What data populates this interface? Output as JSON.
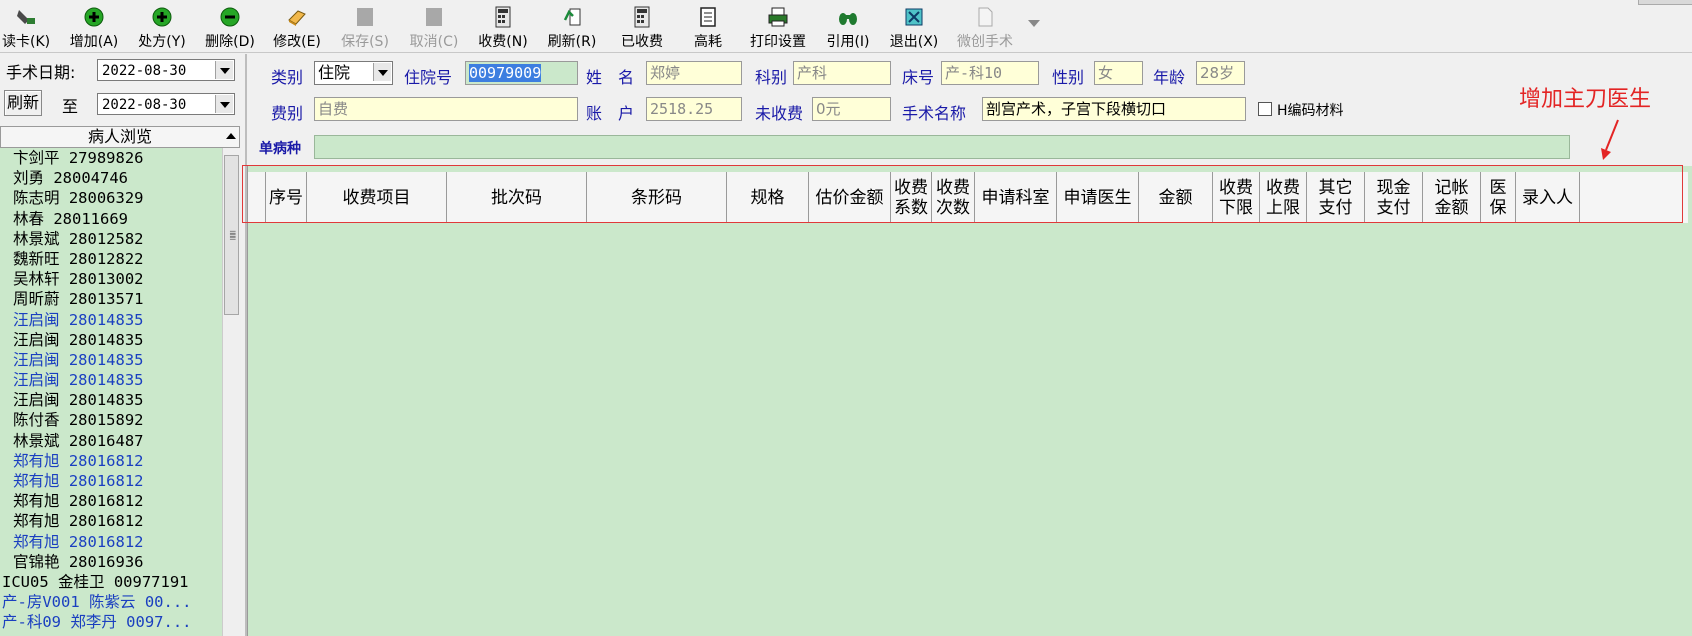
{
  "toolbar": {
    "buttons": [
      {
        "label": "读卡(K)",
        "icon": "card-reader-icon",
        "disabled": false
      },
      {
        "label": "增加(A)",
        "icon": "plus-circle-icon",
        "disabled": false
      },
      {
        "label": "处方(Y)",
        "icon": "plus-circle-icon",
        "disabled": false
      },
      {
        "label": "删除(D)",
        "icon": "minus-circle-icon",
        "disabled": false
      },
      {
        "label": "修改(E)",
        "icon": "eraser-icon",
        "disabled": false
      },
      {
        "label": "保存(S)",
        "icon": "save-icon",
        "disabled": true
      },
      {
        "label": "取消(C)",
        "icon": "cancel-icon",
        "disabled": true
      },
      {
        "label": "收费(N)",
        "icon": "calculator-icon",
        "disabled": false
      },
      {
        "label": "刷新(R)",
        "icon": "refresh-icon",
        "disabled": false
      },
      {
        "label": "已收费",
        "icon": "calculator-icon",
        "disabled": false
      },
      {
        "label": "高耗",
        "icon": "document-icon",
        "disabled": false
      },
      {
        "label": "打印设置",
        "icon": "printer-icon",
        "disabled": false
      },
      {
        "label": "引用(I)",
        "icon": "binoculars-icon",
        "disabled": false
      },
      {
        "label": "退出(X)",
        "icon": "exit-icon",
        "disabled": false
      },
      {
        "label": "微创手术",
        "icon": "page-icon",
        "disabled": true
      }
    ]
  },
  "left_panel": {
    "surgery_date_label": "手术日期:",
    "date_from": "2022-08-30",
    "refresh_label": "刷新",
    "to_label": "至",
    "date_to": "2022-08-30",
    "browse_title": "病人浏览",
    "patients": [
      {
        "text": "卞剑平 27989826",
        "blue": false
      },
      {
        "text": "刘勇 28004746",
        "blue": false
      },
      {
        "text": "陈志明 28006329",
        "blue": false
      },
      {
        "text": "林春 28011669",
        "blue": false
      },
      {
        "text": "林景斌 28012582",
        "blue": false
      },
      {
        "text": "魏新旺 28012822",
        "blue": false
      },
      {
        "text": "吴林轩 28013002",
        "blue": false
      },
      {
        "text": "周昕蔚 28013571",
        "blue": false
      },
      {
        "text": "汪启闽 28014835",
        "blue": true
      },
      {
        "text": "汪启闽 28014835",
        "blue": false
      },
      {
        "text": "汪启闽 28014835",
        "blue": true
      },
      {
        "text": "汪启闽 28014835",
        "blue": true
      },
      {
        "text": "汪启闽 28014835",
        "blue": false
      },
      {
        "text": "陈付香 28015892",
        "blue": false
      },
      {
        "text": "林景斌 28016487",
        "blue": false
      },
      {
        "text": "郑有旭 28016812",
        "blue": true
      },
      {
        "text": "郑有旭 28016812",
        "blue": true
      },
      {
        "text": "郑有旭 28016812",
        "blue": false
      },
      {
        "text": "郑有旭 28016812",
        "blue": false
      },
      {
        "text": "郑有旭 28016812",
        "blue": true
      },
      {
        "text": "官锦艳 28016936",
        "blue": false
      },
      {
        "text": "ICU05 金桂卫 00977191",
        "blue": false,
        "flush": true
      },
      {
        "text": "产-房V001 陈紫云 00...",
        "blue": true,
        "flush": true
      },
      {
        "text": "产-科09 郑李丹 0097...",
        "blue": true,
        "flush": true
      }
    ]
  },
  "form": {
    "type_label": "类别",
    "type_value": "住院",
    "inpatient_no_label": "住院号",
    "inpatient_no": "00979009",
    "name_label": "姓　名",
    "name_value": "郑婷",
    "dept_label": "科别",
    "dept_value": "产科",
    "bed_label": "床号",
    "bed_value": "产-科10",
    "gender_label": "性别",
    "gender_value": "女",
    "age_label": "年龄",
    "age_value": "28岁",
    "fee_type_label": "费别",
    "fee_type_value": "自费",
    "account_label": "账　户",
    "account_value": "2518.25",
    "unpaid_label": "未收费",
    "unpaid_value": "0元",
    "surgery_name_label": "手术名称",
    "surgery_name_value": "剖宫产术，子宫下段横切口",
    "h_code_label": "H编码材料",
    "single_disease_label": "单病种"
  },
  "grid": {
    "columns": [
      "序号",
      "收费项目",
      "批次码",
      "条形码",
      "规格",
      "估价金额",
      "收费\n系数",
      "收费\n次数",
      "申请科室",
      "申请医生",
      "金额",
      "收费\n下限",
      "收费\n上限",
      "其它\n支付",
      "现金\n支付",
      "记帐\n金额",
      "医\n保",
      "录入人"
    ]
  },
  "annotation": {
    "text": "增加主刀医生",
    "color": "#e32424"
  },
  "colors": {
    "grid_bg": "#cbe8cb",
    "field_bg": "#ffffd8",
    "label_blue": "#1a1aa8",
    "highlight_red": "#e0393a"
  }
}
